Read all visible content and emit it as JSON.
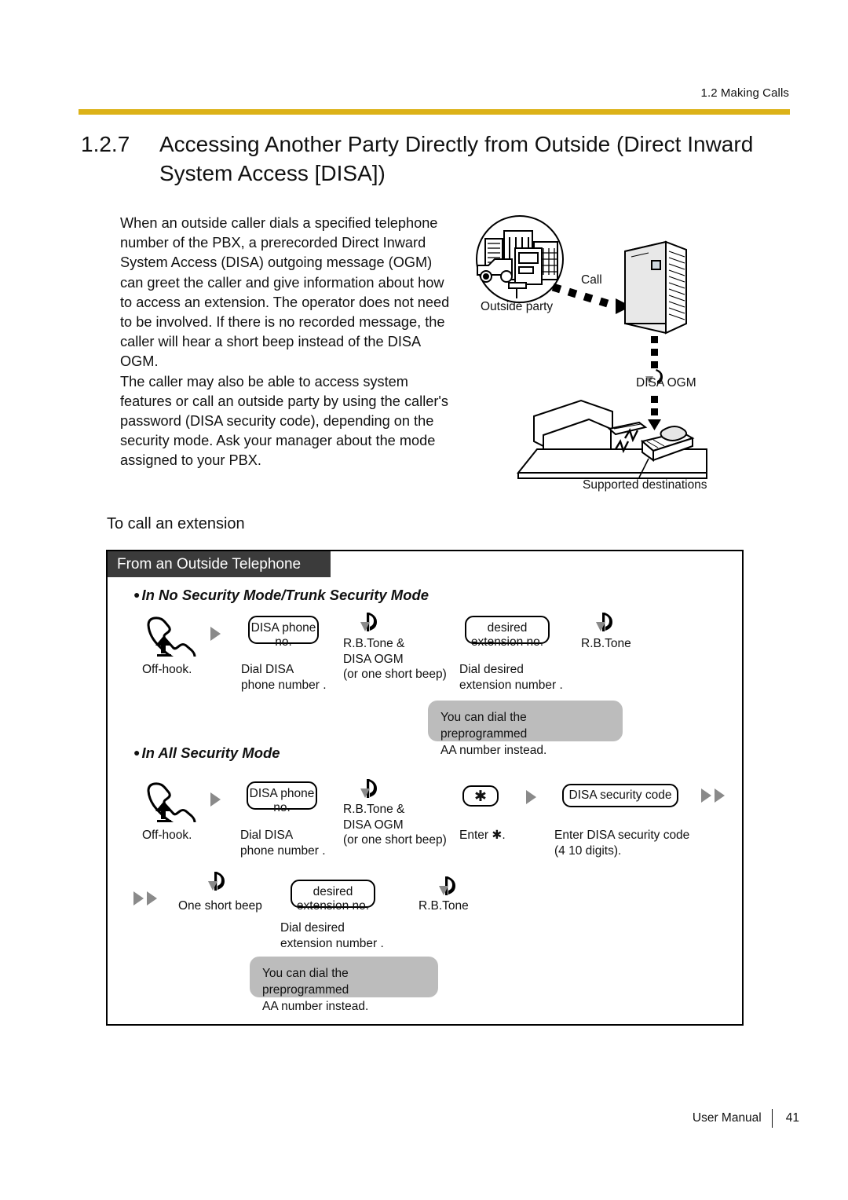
{
  "header": {
    "running_head": "1.2 Making Calls",
    "rule_color": "#dcb218"
  },
  "section": {
    "number": "1.2.7",
    "title": "Accessing Another Party Directly from Outside (Direct Inward System Access [DISA])"
  },
  "intro": {
    "paragraph_1": "When an outside caller dials a specified telephone number of the PBX, a prerecorded Direct Inward System Access (DISA) outgoing message (OGM) can greet the caller and give information about how to access an extension. The operator does not need to be involved. If there is no recorded message, the caller will hear a short beep instead of the DISA OGM.",
    "paragraph_2": "The caller may also be able to access system features or call an outside party by using the caller's password (DISA security code), depending on the security mode. Ask your manager about the mode assigned to your PBX."
  },
  "illustration": {
    "label_call": "Call",
    "label_outside_party": "Outside party",
    "label_disa_ogm": "DISA OGM",
    "label_supported_destinations": "Supported destinations"
  },
  "subsection": {
    "title": "To call an extension"
  },
  "box": {
    "title": "From an Outside Telephone"
  },
  "mode_1": {
    "heading": "In No Security Mode/Trunk Security Mode",
    "steps": [
      {
        "key": "",
        "caption": "Off-hook."
      },
      {
        "key": "DISA\nphone no.",
        "caption": "Dial DISA\nphone number  ."
      },
      {
        "key": "",
        "caption": "R.B.Tone &\nDISA OGM\n(or one short beep)"
      },
      {
        "key": "desired\nextension no.",
        "caption": "Dial desired\nextension number  ."
      },
      {
        "key": "",
        "caption": "R.B.Tone"
      }
    ],
    "balloon": "You can dial the preprogrammed\nAA number instead."
  },
  "mode_2": {
    "heading": "In All Security Mode",
    "steps_row1": [
      {
        "key": "",
        "caption": "Off-hook."
      },
      {
        "key": "DISA\nphone no.",
        "caption": "Dial DISA\nphone number  ."
      },
      {
        "key": "",
        "caption": "R.B.Tone &\nDISA OGM\n(or one short beep)"
      },
      {
        "key": "✱",
        "caption": "Enter ✱."
      },
      {
        "key": "DISA security code",
        "caption": "Enter DISA security code\n(4  10 digits)."
      }
    ],
    "steps_row2": [
      {
        "key": "",
        "caption": "One short beep"
      },
      {
        "key": "desired\nextension no.",
        "caption": "Dial desired\nextension number  ."
      },
      {
        "key": "",
        "caption": "R.B.Tone"
      }
    ],
    "balloon": "You can dial the preprogrammed\nAA number instead."
  },
  "footer": {
    "manual_name": "User Manual",
    "page_number": "41"
  }
}
